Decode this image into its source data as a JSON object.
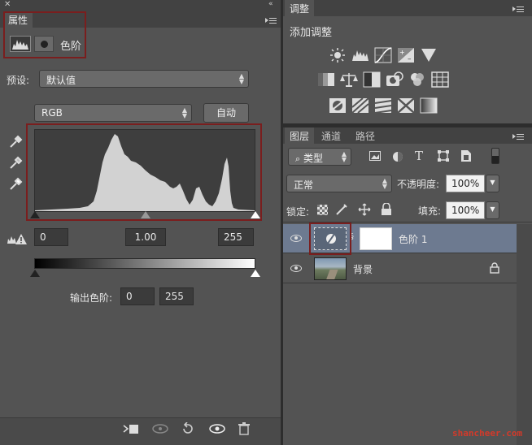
{
  "properties": {
    "tab_label": "属性",
    "title": "色阶",
    "preset_label": "预设:",
    "preset_value": "默认值",
    "channel_value": "RGB",
    "auto_button": "自动",
    "input_black": "0",
    "input_gamma": "1.00",
    "input_white": "255",
    "output_label": "输出色阶:",
    "output_black": "0",
    "output_white": "255"
  },
  "adjustments": {
    "tab_label": "调整",
    "add_label": "添加调整",
    "icons_row1": [
      "brightness-contrast-icon",
      "levels-icon",
      "curves-icon",
      "exposure-icon",
      "vibrance-icon"
    ],
    "icons_row2": [
      "hue-saturation-icon",
      "color-balance-icon",
      "black-white-icon",
      "photo-filter-icon",
      "channel-mixer-icon",
      "color-lookup-icon"
    ],
    "icons_row3": [
      "invert-icon",
      "posterize-icon",
      "threshold-icon",
      "selective-color-icon",
      "gradient-map-icon"
    ]
  },
  "layers_panel": {
    "tabs": [
      "图层",
      "通道",
      "路径"
    ],
    "filter_label": "类型",
    "blend_mode": "正常",
    "opacity_label": "不透明度:",
    "opacity_value": "100%",
    "lock_label": "锁定:",
    "fill_label": "填充:",
    "fill_value": "100%",
    "layers": [
      {
        "name": "色阶 1",
        "selected": true
      },
      {
        "name": "背景",
        "selected": false
      }
    ]
  },
  "watermark": "shancheer.com",
  "colors": {
    "panel": "#535353",
    "selected_layer": "#6d7a90",
    "highlight_box": "#7a1e1e"
  }
}
